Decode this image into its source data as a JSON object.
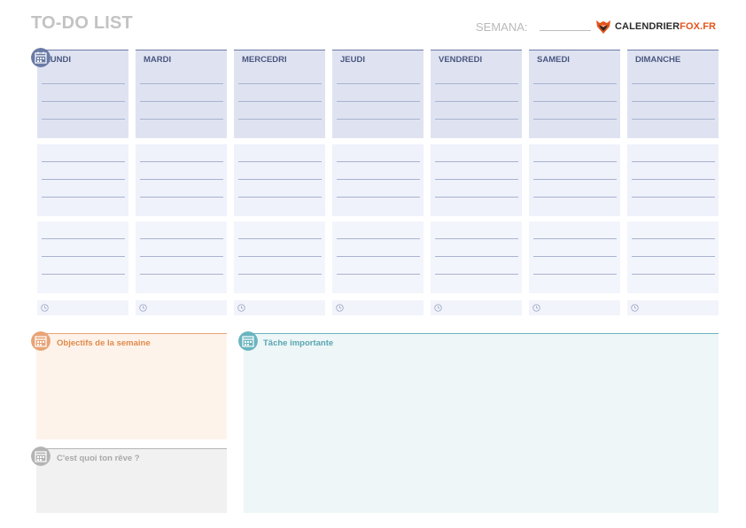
{
  "header": {
    "title": "TO-DO LIST",
    "week_label": "SEMANA:",
    "logo_part1": "CALENDRIER",
    "logo_part2": "FOX.FR"
  },
  "days": [
    "LUNDI",
    "MARDI",
    "MERCEDRI",
    "JEUDI",
    "VENDREDI",
    "SAMEDI",
    "DIMANCHE"
  ],
  "sections": {
    "objectives": "Objectifs de la semaine",
    "important_task": "Tâche importante",
    "dream": "C'est quoi ton rêve ?"
  },
  "icons": {
    "calendar": "calendar-icon",
    "clock": "clock-icon",
    "logo": "fox-logo-icon"
  },
  "colors": {
    "navy": "#6a7aa6",
    "header_fill": "#dfe3f1",
    "orange": "#e8a476",
    "teal": "#6ab5bf",
    "gray": "#b4b4b4",
    "brand": "#e5551c"
  }
}
